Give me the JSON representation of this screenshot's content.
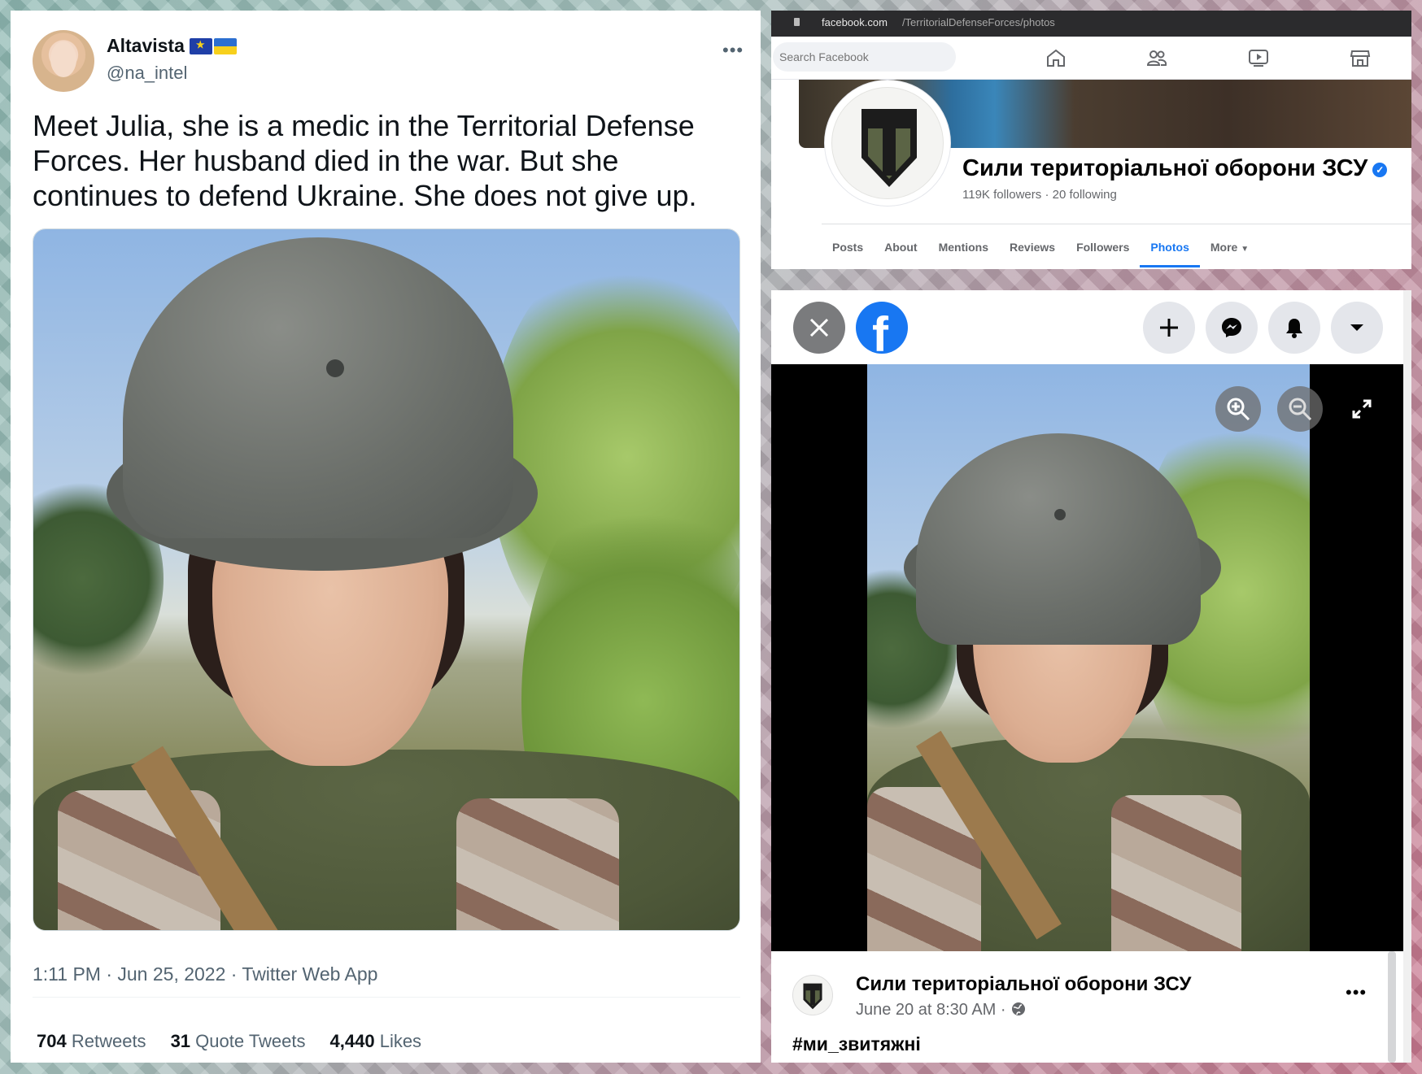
{
  "tweet": {
    "author_name": "Altavista",
    "author_handle": "@na_intel",
    "more_label": "•••",
    "text": "Meet Julia, she is a medic in the Territorial Defense Forces. Her husband died in the war. But she continues to defend Ukraine. She does not give up.",
    "meta": "1:11 PM · Jun 25, 2022 · Twitter Web App",
    "stats": {
      "retweets_count": "704",
      "retweets_label": "Retweets",
      "quotes_count": "31",
      "quotes_label": "Quote Tweets",
      "likes_count": "4,440",
      "likes_label": "Likes"
    },
    "flags": [
      "eu-flag-icon",
      "ukraine-flag-icon"
    ]
  },
  "facebook_page": {
    "url_domain": "facebook.com",
    "url_path": "/TerritorialDefenseForces/photos",
    "search_placeholder": "Search Facebook",
    "nav_icons": [
      "home-icon",
      "friends-icon",
      "watch-icon",
      "marketplace-icon"
    ],
    "page_name": "Сили територіальної оборони ЗСУ",
    "followers": "119K followers",
    "following": "20 following",
    "tabs": [
      "Posts",
      "About",
      "Mentions",
      "Reviews",
      "Followers",
      "Photos",
      "More"
    ],
    "active_tab": "Photos",
    "accent_color": "#1877f2"
  },
  "facebook_viewer": {
    "left_icons": [
      "close-icon",
      "facebook-logo-icon"
    ],
    "right_icons": [
      "plus-icon",
      "messenger-icon",
      "bell-icon",
      "caret-down-icon"
    ],
    "photo_controls": [
      "zoom-in-icon",
      "zoom-out-icon",
      "fullscreen-icon"
    ],
    "post": {
      "author": "Сили територіальної оборони ЗСУ",
      "time": "June 20 at 8:30 AM ·",
      "more_label": "•••",
      "hashtag": "#ми_звитяжні"
    }
  }
}
